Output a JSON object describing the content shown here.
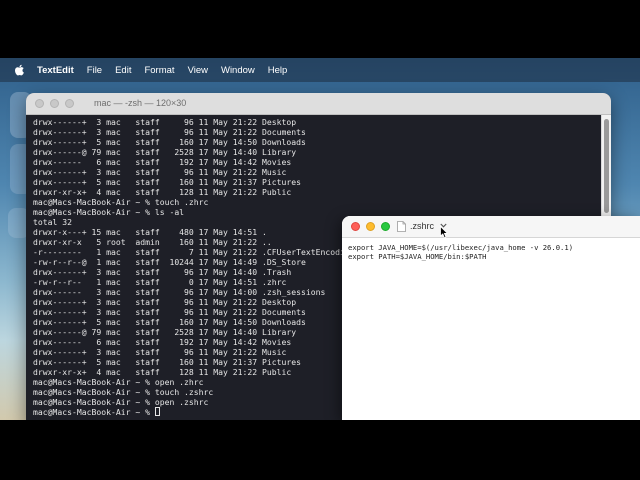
{
  "menubar": {
    "app_name": "TextEdit",
    "items": [
      "File",
      "Edit",
      "Format",
      "View",
      "Window",
      "Help"
    ]
  },
  "terminal": {
    "title": "mac — -zsh — 120×30",
    "lines": [
      "drwx------+  3 mac   staff     96 11 May 21:22 Desktop",
      "drwx------+  3 mac   staff     96 11 May 21:22 Documents",
      "drwx------+  5 mac   staff    160 17 May 14:50 Downloads",
      "drwx------@ 79 mac   staff   2528 17 May 14:40 Library",
      "drwx------   6 mac   staff    192 17 May 14:42 Movies",
      "drwx------+  3 mac   staff     96 11 May 21:22 Music",
      "drwx------+  5 mac   staff    160 11 May 21:37 Pictures",
      "drwxr-xr-x+  4 mac   staff    128 11 May 21:22 Public",
      "mac@Macs-MacBook-Air ~ % touch .zhrc",
      "mac@Macs-MacBook-Air ~ % ls -al",
      "total 32",
      "drwxr-x---+ 15 mac   staff    480 17 May 14:51 .",
      "drwxr-xr-x   5 root  admin    160 11 May 21:22 ..",
      "-r--------   1 mac   staff      7 11 May 21:22 .CFUserTextEncoding",
      "-rw-r--r--@  1 mac   staff  10244 17 May 14:49 .DS_Store",
      "drwx------+  3 mac   staff     96 17 May 14:40 .Trash",
      "-rw-r--r--   1 mac   staff      0 17 May 14:51 .zhrc",
      "drwx------   3 mac   staff     96 17 May 14:00 .zsh_sessions",
      "drwx------+  3 mac   staff     96 11 May 21:22 Desktop",
      "drwx------+  3 mac   staff     96 11 May 21:22 Documents",
      "drwx------+  5 mac   staff    160 17 May 14:50 Downloads",
      "drwx------@ 79 mac   staff   2528 17 May 14:40 Library",
      "drwx------   6 mac   staff    192 17 May 14:42 Movies",
      "drwx------+  3 mac   staff     96 11 May 21:22 Music",
      "drwx------+  5 mac   staff    160 11 May 21:37 Pictures",
      "drwxr-xr-x+  4 mac   staff    128 11 May 21:22 Public",
      "mac@Macs-MacBook-Air ~ % open .zhrc",
      "mac@Macs-MacBook-Air ~ % touch .zshrc",
      "mac@Macs-MacBook-Air ~ % open .zshrc"
    ],
    "prompt": "mac@Macs-MacBook-Air ~ % "
  },
  "textedit": {
    "filename": ".zshrc",
    "lines": [
      "export JAVA_HOME=$(/usr/libexec/java_home -v 26.0.1)",
      "export PATH=$JAVA_HOME/bin:$PATH"
    ]
  },
  "icons": {
    "apple": "apple-logo-icon",
    "document": "document-icon",
    "chevron": "chevron-down-icon",
    "pointer": "mouse-pointer-icon"
  },
  "colors": {
    "terminal_bg": "#1e1f27",
    "terminal_text": "#e6e6e6",
    "close": "#fe5f57",
    "minimize": "#febc2e",
    "zoom": "#28c840"
  }
}
